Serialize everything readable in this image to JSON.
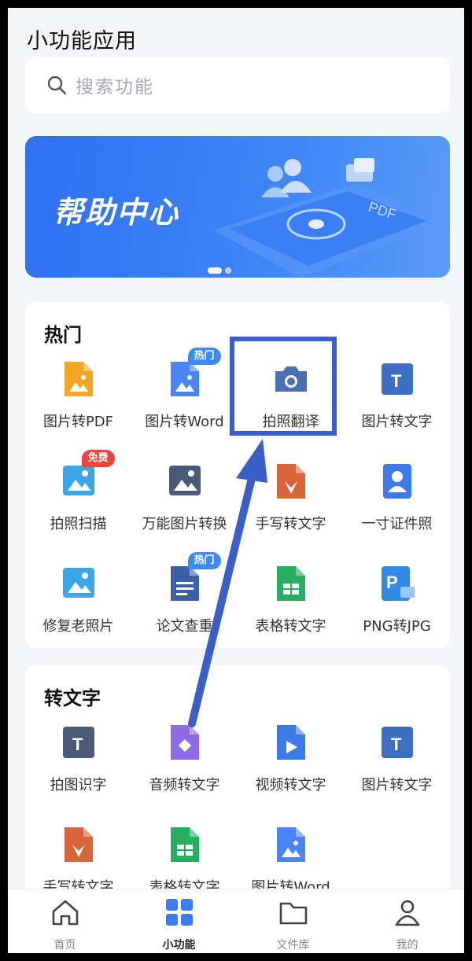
{
  "header": {
    "title": "小功能应用"
  },
  "search": {
    "placeholder": "搜索功能"
  },
  "banner": {
    "text": "帮助中心",
    "art_label": "PDF"
  },
  "hot": {
    "title": "热门",
    "items": [
      {
        "label": "图片转PDF",
        "icon": "image-to-pdf-icon",
        "color": "#f5a623"
      },
      {
        "label": "图片转Word",
        "icon": "image-to-word-icon",
        "color": "#4a84f5",
        "badge": "热门"
      },
      {
        "label": "拍照翻译",
        "icon": "camera-icon",
        "color": "#4a6fb5"
      },
      {
        "label": "图片转文字",
        "icon": "image-to-text-icon",
        "color": "#3d6fc2"
      },
      {
        "label": "拍照扫描",
        "icon": "photo-scan-icon",
        "color": "#3aa6e8",
        "badge": "免费"
      },
      {
        "label": "万能图片转换",
        "icon": "image-convert-icon",
        "color": "#4a5a78"
      },
      {
        "label": "手写转文字",
        "icon": "handwriting-icon",
        "color": "#d9663a"
      },
      {
        "label": "一寸证件照",
        "icon": "id-photo-icon",
        "color": "#3d7ae8"
      },
      {
        "label": "修复老照片",
        "icon": "photo-repair-icon",
        "color": "#3aa6e8"
      },
      {
        "label": "论文查重",
        "icon": "paper-check-icon",
        "color": "#3d5fa8",
        "badge": "热门"
      },
      {
        "label": "表格转文字",
        "icon": "spreadsheet-icon",
        "color": "#27ae60"
      },
      {
        "label": "PNG转JPG",
        "icon": "png-to-jpg-icon",
        "color": "#2f8ae6"
      }
    ]
  },
  "to_text": {
    "title": "转文字",
    "items": [
      {
        "label": "拍图识字",
        "icon": "photo-ocr-icon",
        "color": "#4a5a78"
      },
      {
        "label": "音频转文字",
        "icon": "audio-to-text-icon",
        "color": "#8e6ce8"
      },
      {
        "label": "视频转文字",
        "icon": "video-to-text-icon",
        "color": "#3d7ae8"
      },
      {
        "label": "图片转文字",
        "icon": "image-to-text-icon",
        "color": "#3d6fc2"
      },
      {
        "label": "手写转文字",
        "icon": "handwriting-icon",
        "color": "#d9663a"
      },
      {
        "label": "表格转文字",
        "icon": "spreadsheet-icon",
        "color": "#27ae60"
      },
      {
        "label": "图片转Word",
        "icon": "image-to-word-icon",
        "color": "#4a84f5"
      }
    ]
  },
  "tabbar": {
    "tabs": [
      {
        "label": "首页",
        "icon": "home-icon"
      },
      {
        "label": "小功能",
        "icon": "grid-icon",
        "active": true
      },
      {
        "label": "文件库",
        "icon": "folder-icon"
      },
      {
        "label": "我的",
        "icon": "user-icon"
      }
    ]
  },
  "colors": {
    "accent": "#2f6ff2",
    "highlight": "#3a5fc8"
  }
}
